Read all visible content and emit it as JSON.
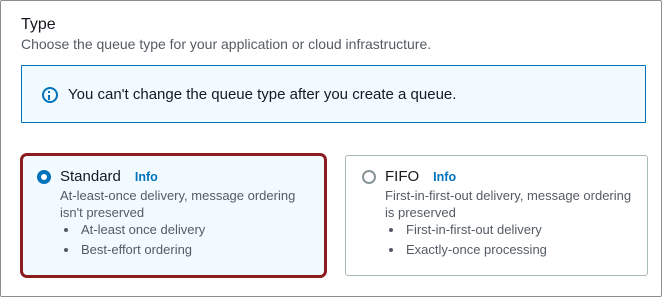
{
  "section": {
    "title": "Type",
    "description": "Choose the queue type for your application or cloud infrastructure."
  },
  "alert": {
    "icon": "info-circle-icon",
    "text": "You can't change the queue type after you create a queue.",
    "color": "#0073bb"
  },
  "options": [
    {
      "title": "Standard",
      "info_label": "Info",
      "selected": true,
      "description": "At-least-once delivery, message ordering isn't preserved",
      "features": [
        "At-least once delivery",
        "Best-effort ordering"
      ]
    },
    {
      "title": "FIFO",
      "info_label": "Info",
      "selected": false,
      "description": "First-in-first-out delivery, message ordering is preserved",
      "features": [
        "First-in-first-out delivery",
        "Exactly-once processing"
      ]
    }
  ],
  "colors": {
    "accent": "#0073bb",
    "highlight_border": "#8b1d1f",
    "selected_bg": "#f1faff"
  }
}
